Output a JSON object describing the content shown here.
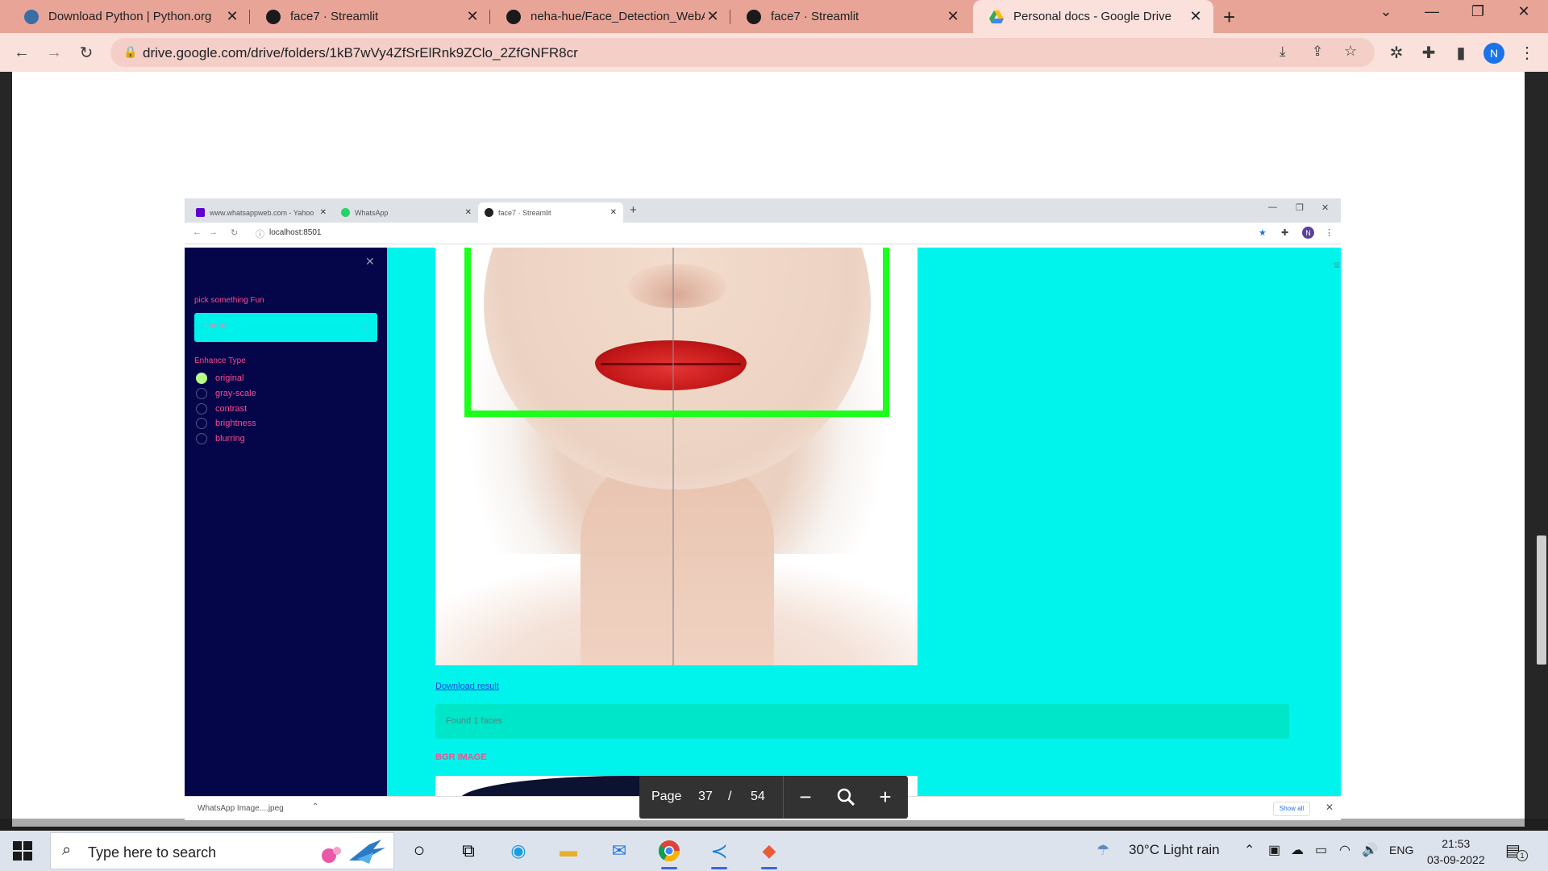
{
  "browser": {
    "tabs": [
      {
        "title": "Download Python | Python.org",
        "favicon": "python-icon"
      },
      {
        "title": "face7 · Streamlit",
        "favicon": "streamlit-icon"
      },
      {
        "title": "neha-hue/Face_Detection_WebA",
        "favicon": "github-icon"
      },
      {
        "title": "face7 · Streamlit",
        "favicon": "streamlit-icon"
      },
      {
        "title": "Personal docs - Google Drive",
        "favicon": "google-drive-icon",
        "active": true
      }
    ],
    "url": "drive.google.com/drive/folders/1kB7wVy4ZfSrElRnk9ZClo_2ZfGNFR8cr",
    "profile_initial": "N",
    "accent": "#e8a597"
  },
  "inner_browser": {
    "tabs": [
      {
        "title": "www.whatsappweb.com - Yahoo"
      },
      {
        "title": "WhatsApp"
      },
      {
        "title": "face7 · Streamlit",
        "active": true
      }
    ],
    "url": "localhost:8501",
    "profile_initial": "N"
  },
  "app": {
    "sidebar": {
      "select_label": "pick something Fun",
      "select_value": "Home",
      "enhance_label": "Enhance Type",
      "options": [
        "original",
        "gray-scale",
        "contrast",
        "brightness",
        "blurring"
      ],
      "selected": "original"
    },
    "download_link": "Download result",
    "found_message": "Found 1 faces",
    "section_heading": "BGR IMAGE",
    "colors": {
      "sidebar": "#05054a",
      "main": "#00f4ec",
      "accent_text": "#ff4b8c",
      "box": "#1bff1b"
    }
  },
  "downloads": {
    "file": "WhatsApp Image....jpeg",
    "show_all": "Show all"
  },
  "viewer": {
    "page_label": "Page",
    "current_page": "37",
    "separator": "/",
    "total_pages": "54"
  },
  "taskbar": {
    "search_placeholder": "Type here to search",
    "weather": "30°C  Light rain",
    "language": "ENG",
    "time": "21:53",
    "date": "03-09-2022",
    "notification_count": "1"
  }
}
